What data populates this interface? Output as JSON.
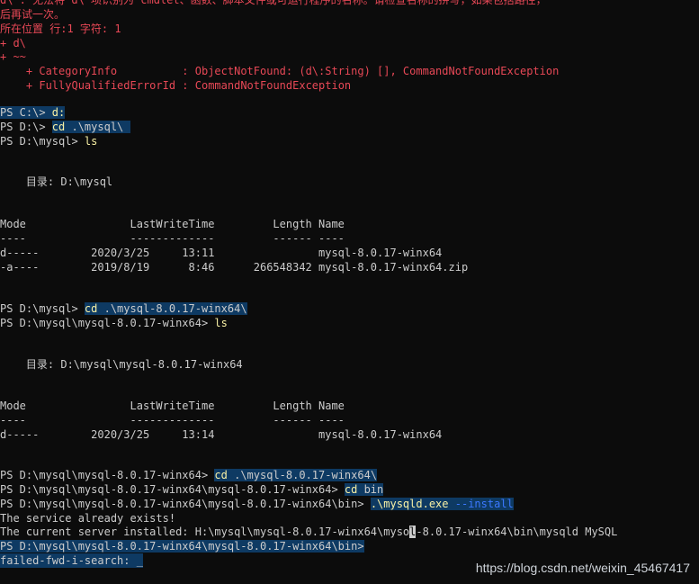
{
  "errors": {
    "line1": "d\\ : 无法将“d\\”项识别为 cmdlet、函数、脚本文件或可运行程序的名称。请检查名称的拼写，如果包括路径，",
    "line2": "后再试一次。",
    "position": "所在位置 行:1 字符: 1",
    "plus_cmd": "+ d\\",
    "plus_caret": "+ ~~",
    "category_key": "    + CategoryInfo          ",
    "category_val": ": ObjectNotFound: (d\\:String) [], CommandNotFoundException",
    "fqid_key": "    + FullyQualifiedErrorId ",
    "fqid_val": ": CommandNotFoundException"
  },
  "session": {
    "p1_prompt": "PS C:\\> ",
    "p1_cmd": "d:",
    "p2_prompt": "PS D:\\> ",
    "p2_cmd": "cd",
    "p2_arg": " .\\mysql\\ ",
    "p3_prompt": "PS D:\\mysql> ",
    "p3_cmd": "ls"
  },
  "listing1": {
    "dir_label": "    目录: D:\\mysql",
    "header": "Mode                LastWriteTime         Length Name",
    "divider": "----                -------------         ------ ----",
    "row1": "d-----        2020/3/25     13:11                mysql-8.0.17-winx64",
    "row2": "-a----        2019/8/19      8:46      266548342 mysql-8.0.17-winx64.zip"
  },
  "session2": {
    "p4_prompt": "PS D:\\mysql> ",
    "p4_cmd": "cd",
    "p4_arg": " .\\mysql-8.0.17-winx64\\",
    "p5_prompt": "PS D:\\mysql\\mysql-8.0.17-winx64> ",
    "p5_cmd": "ls"
  },
  "listing2": {
    "dir_label": "    目录: D:\\mysql\\mysql-8.0.17-winx64",
    "header": "Mode                LastWriteTime         Length Name",
    "divider": "----                -------------         ------ ----",
    "row1": "d-----        2020/3/25     13:14                mysql-8.0.17-winx64"
  },
  "session3": {
    "p6_prompt": "PS D:\\mysql\\mysql-8.0.17-winx64> ",
    "p6_cmd": "cd",
    "p6_arg": " .\\mysql-8.0.17-winx64\\",
    "p7_prompt": "PS D:\\mysql\\mysql-8.0.17-winx64\\mysql-8.0.17-winx64> ",
    "p7_cmd": "cd",
    "p7_arg": " bin",
    "p8_prompt": "PS D:\\mysql\\mysql-8.0.17-winx64\\mysql-8.0.17-winx64\\bin> ",
    "p8_cmd": ".\\mysqld.exe",
    "p8_flag": " --install",
    "out1": "The service already exists!",
    "out2_a": "The current server installed: H:\\mysql\\mysql-8.0.17-winx64\\myso",
    "out2_cursor": "l",
    "out2_b": "-8.0.17-winx64\\bin\\mysqld MySQL",
    "p9_prompt": "PS D:\\mysql\\mysql-8.0.17-winx64\\mysql-8.0.17-winx64\\bin>",
    "search": "failed-fwd-i-search: _"
  },
  "watermark": "https://blog.csdn.net/weixin_45467417",
  "colors": {
    "background": "#0c0c0c",
    "text": "#cccccc",
    "error": "#e74856",
    "command": "#f9f1a5",
    "selection": "#0e3a63"
  }
}
